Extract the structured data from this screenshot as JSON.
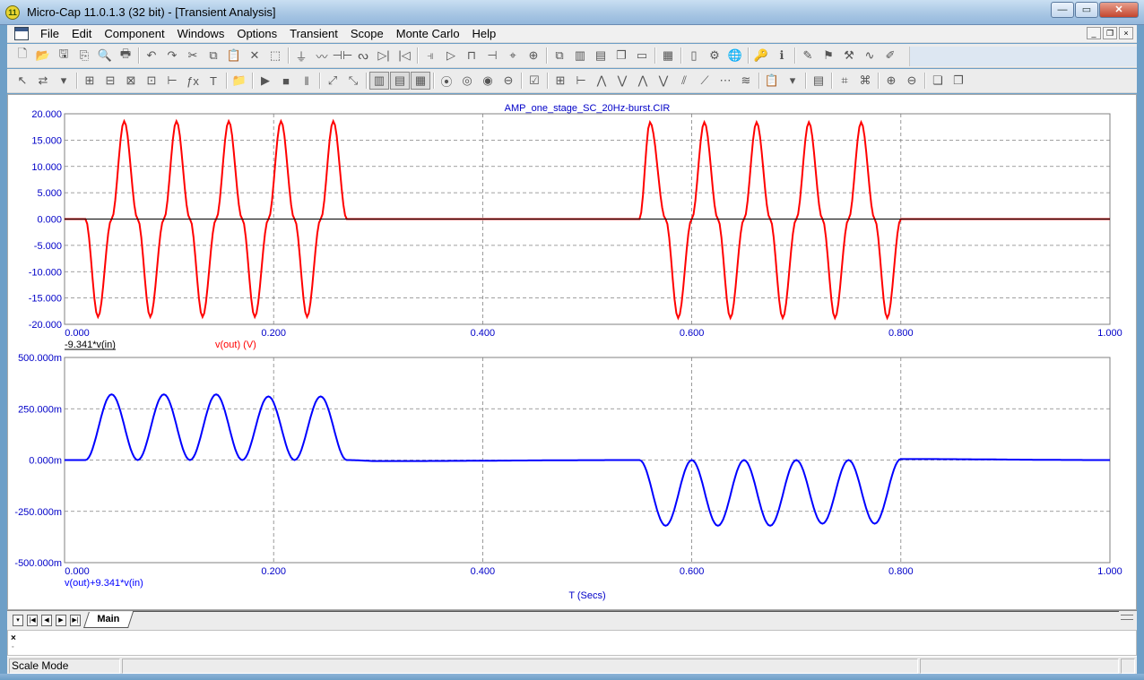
{
  "window": {
    "title": "Micro-Cap 11.0.1.3 (32 bit) - [Transient Analysis]",
    "app_icon_glyph": "11",
    "buttons": {
      "minimize": "—",
      "maximize": "▭",
      "close": "✕"
    }
  },
  "menu": {
    "items": [
      "File",
      "Edit",
      "Component",
      "Windows",
      "Options",
      "Transient",
      "Scope",
      "Monte Carlo",
      "Help"
    ],
    "mdi_buttons": [
      "_",
      "❐",
      "×"
    ]
  },
  "toolbar1": {
    "icons": [
      "new-file-icon",
      "open-file-icon",
      "save-icon",
      "properties-icon",
      "print-preview-icon",
      "print-icon",
      "sep",
      "undo-icon",
      "redo-icon",
      "cut-icon",
      "copy-icon",
      "paste-icon",
      "delete-icon",
      "select-all-icon",
      "sep",
      "ground-icon",
      "resistor-icon",
      "capacitor-icon",
      "inductor-icon",
      "diode-icon",
      "diode2-icon",
      "sep",
      "npn-icon",
      "opamp-icon",
      "pulse-icon",
      "battery-icon",
      "node-icon",
      "probe-icon",
      "sep",
      "cascade-icon",
      "tile-vertical-icon",
      "tile-horizontal-icon",
      "window-icon",
      "window2-icon",
      "sep",
      "calculator-icon",
      "sep",
      "page-icon",
      "component-editor-icon",
      "globe-icon",
      "sep",
      "key-icon",
      "info-icon",
      "sep",
      "edit-properties-icon",
      "flag-icon",
      "tools-icon",
      "analysis-icon",
      "pen-icon"
    ],
    "glyphs": [
      "🗋",
      "📂",
      "🖫",
      "⎘",
      "🔍",
      "🖶",
      "",
      "↶",
      "↷",
      "✂",
      "⧉",
      "📋",
      "✕",
      "⬚",
      "",
      "⏚",
      "〰",
      "⊣⊢",
      "ᔓ",
      "▷|",
      "|◁",
      "",
      "⫣",
      "▷",
      "⊓",
      "⊣",
      "⌖",
      "⊕",
      "",
      "⧉",
      "▥",
      "▤",
      "❐",
      "▭",
      "",
      "▦",
      "",
      "▯",
      "⚙",
      "🌐",
      "",
      "🔑",
      "ℹ",
      "",
      "✎",
      "⚑",
      "⚒",
      "∿",
      "✐"
    ]
  },
  "toolbar2": {
    "glyphs": [
      "↖",
      "⇄",
      "▾",
      "",
      "⊞",
      "⊟",
      "⊠",
      "⊡",
      "⊢",
      "ƒx",
      "T",
      "",
      "📁",
      "",
      "▶",
      "■",
      "‖",
      "",
      "⤢",
      "⤡",
      "",
      "▥",
      "▤",
      "▦",
      "",
      "⦿",
      "◎",
      "◉",
      "⊖",
      "",
      "☑",
      "",
      "⊞",
      "⊢",
      "⋀",
      "⋁",
      "⋀",
      "⋁",
      "⫽",
      "⟋",
      "⋯",
      "≋",
      "",
      "📋",
      "▾",
      "",
      "▤",
      "",
      "⌗",
      "⌘",
      "",
      "⊕",
      "⊖",
      "",
      "❏",
      "❐"
    ],
    "pressed": [
      21,
      22,
      23
    ]
  },
  "plot": {
    "title": "AMP_one_stage_SC_20Hz-burst.CIR",
    "x_axis_title": "T (Secs)",
    "top": {
      "y_ticks": [
        "20.000",
        "15.000",
        "10.000",
        "5.000",
        "0.000",
        "-5.000",
        "-10.000",
        "-15.000",
        "-20.000"
      ],
      "x_ticks": [
        "0.000",
        "0.200",
        "0.400",
        "0.600",
        "0.800",
        "1.000"
      ],
      "legend": [
        {
          "label": "-9.341*v(in)",
          "color": "#000000"
        },
        {
          "label": "v(out) (V)",
          "color": "#ff0000"
        }
      ]
    },
    "bottom": {
      "y_ticks": [
        "500.000m",
        "250.000m",
        "0.000m",
        "-250.000m",
        "-500.000m"
      ],
      "x_ticks": [
        "0.000",
        "0.200",
        "0.400",
        "0.600",
        "0.800",
        "1.000"
      ],
      "legend": [
        {
          "label": "v(out)+9.341*v(in)",
          "color": "#0000ff"
        }
      ]
    }
  },
  "chart_data": [
    {
      "type": "line",
      "title": "AMP_one_stage_SC_20Hz-burst.CIR",
      "xlabel": "",
      "ylabel": "",
      "xlim": [
        0,
        1
      ],
      "ylim": [
        -20,
        20
      ],
      "grid": true,
      "series": [
        {
          "name": "v(out) (V)",
          "color": "#ff0000",
          "x": [
            0,
            0.02,
            0.032,
            0.045,
            0.057,
            0.07,
            0.082,
            0.095,
            0.107,
            0.12,
            0.132,
            0.145,
            0.157,
            0.17,
            0.182,
            0.195,
            0.207,
            0.22,
            0.232,
            0.245,
            0.257,
            0.27,
            0.55,
            0.56,
            0.575,
            0.587,
            0.6,
            0.612,
            0.625,
            0.637,
            0.65,
            0.662,
            0.675,
            0.687,
            0.7,
            0.712,
            0.725,
            0.737,
            0.75,
            0.762,
            0.775,
            0.787,
            0.8,
            1.0
          ],
          "values": [
            0,
            0,
            -18.6,
            0,
            18.6,
            0,
            -18.6,
            0,
            18.6,
            0,
            -18.6,
            0,
            18.6,
            0,
            -18.6,
            0,
            18.6,
            0,
            -18.6,
            0,
            18.6,
            0,
            0,
            18.4,
            0,
            -18.8,
            0,
            18.4,
            0,
            -18.8,
            0,
            18.4,
            0,
            -18.8,
            0,
            18.4,
            0,
            -18.8,
            0,
            18.4,
            0,
            -18.8,
            0,
            0
          ]
        },
        {
          "name": "-9.341*v(in)",
          "color": "#000000",
          "x": [
            0,
            1.0
          ],
          "values": [
            0,
            0
          ]
        }
      ]
    },
    {
      "type": "line",
      "xlabel": "T (Secs)",
      "ylabel": "",
      "xlim": [
        0,
        1
      ],
      "ylim": [
        -0.5,
        0.5
      ],
      "grid": true,
      "series": [
        {
          "name": "v(out)+9.341*v(in)",
          "color": "#0000ff",
          "x": [
            0,
            0.02,
            0.045,
            0.07,
            0.095,
            0.12,
            0.145,
            0.17,
            0.195,
            0.22,
            0.245,
            0.27,
            0.3,
            0.55,
            0.575,
            0.6,
            0.625,
            0.65,
            0.675,
            0.7,
            0.725,
            0.75,
            0.775,
            0.8,
            1.0
          ],
          "values": [
            0,
            0,
            0.32,
            0,
            0.32,
            0,
            0.32,
            0,
            0.31,
            0,
            0.31,
            0,
            -0.005,
            0,
            -0.32,
            0,
            -0.32,
            0,
            -0.32,
            0,
            -0.31,
            0,
            -0.31,
            0.005,
            0
          ]
        }
      ]
    }
  ],
  "tabs": {
    "nav": [
      "▾",
      "|◀",
      "◀",
      "▶",
      "▶|"
    ],
    "active": "Main"
  },
  "command": {
    "close": "×",
    "pin": "◦"
  },
  "status": {
    "mode": "Scale Mode"
  }
}
